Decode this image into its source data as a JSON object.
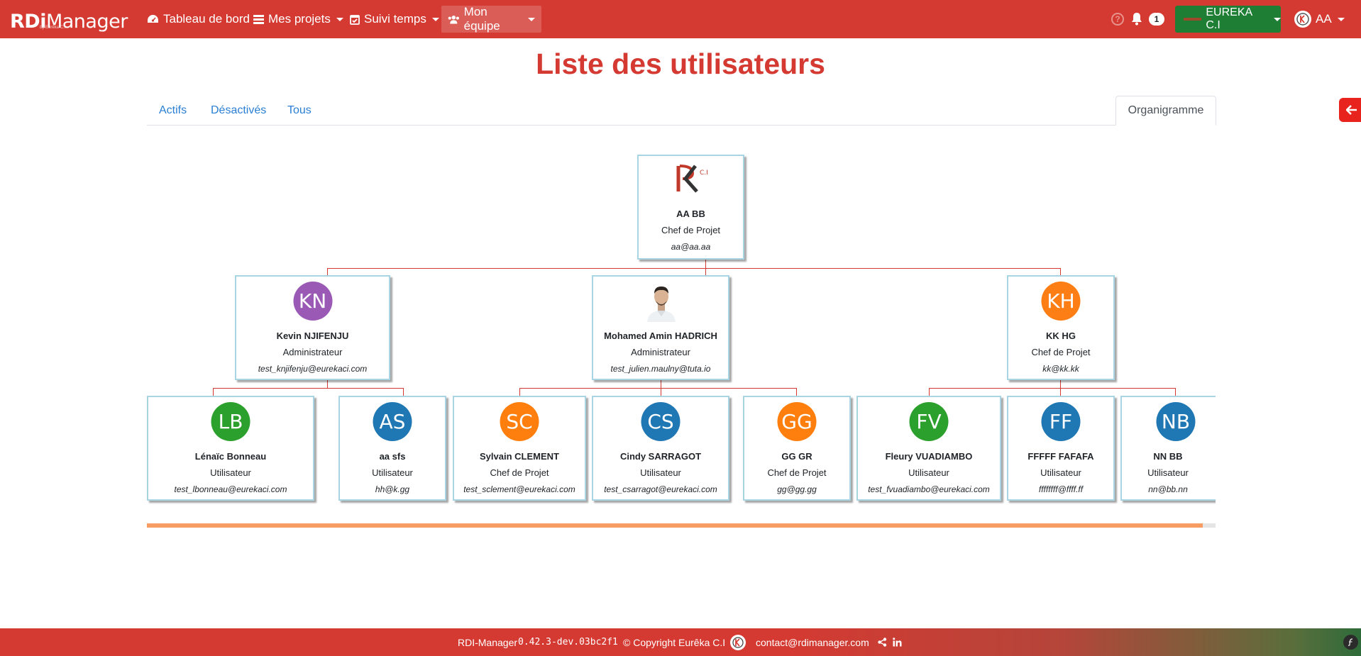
{
  "brand": {
    "name_part1": "RDi",
    "name_part2": "Manager",
    "tagline": "by Eurêka C.I"
  },
  "nav": {
    "items": [
      {
        "label": "Tableau de bord",
        "icon": "dashboard-icon"
      },
      {
        "label": "Mes projets",
        "icon": "list-icon"
      },
      {
        "label": "Suivi temps",
        "icon": "calendar-check-icon"
      },
      {
        "label": "Mon équipe",
        "icon": "users-icon",
        "active": true
      }
    ],
    "help": "?",
    "notifications_count": "1",
    "company": "EUREKA C.I",
    "user": "AA"
  },
  "page": {
    "title": "Liste des utilisateurs"
  },
  "tabs": {
    "active": "Actifs",
    "disabled": "Désactivés",
    "all": "Tous",
    "org": "Organigramme"
  },
  "org": {
    "root": {
      "name": "AA BB",
      "role": "Chef de Projet",
      "email": "aa@aa.aa"
    },
    "level1": [
      {
        "initials": "KN",
        "name": "Kevin NJIFENJU",
        "role": "Administrateur",
        "email": "test_knjifenju@eurekaci.com",
        "color": "#9b59b6"
      },
      {
        "initials": "",
        "name": "Mohamed Amin HADRICH",
        "role": "Administrateur",
        "email": "test_julien.maulny@tuta.io",
        "color": "#ffffff"
      },
      {
        "initials": "KH",
        "name": "KK HG",
        "role": "Chef de Projet",
        "email": "kk@kk.kk",
        "color": "#fd7e14"
      }
    ],
    "level2": [
      {
        "initials": "LB",
        "name": "Lénaïc Bonneau",
        "role": "Utilisateur",
        "email": "test_lbonneau@eurekaci.com",
        "color": "#2ca02c"
      },
      {
        "initials": "AS",
        "name": "aa sfs",
        "role": "Utilisateur",
        "email": "hh@k.gg",
        "color": "#1f77b4"
      },
      {
        "initials": "SC",
        "name": "Sylvain CLEMENT",
        "role": "Chef de Projet",
        "email": "test_sclement@eurekaci.com",
        "color": "#ff7f0e"
      },
      {
        "initials": "CS",
        "name": "Cindy SARRAGOT",
        "role": "Utilisateur",
        "email": "test_csarragot@eurekaci.com",
        "color": "#1f77b4"
      },
      {
        "initials": "GG",
        "name": "GG GR",
        "role": "Chef de Projet",
        "email": "gg@gg.gg",
        "color": "#ff7f0e"
      },
      {
        "initials": "FV",
        "name": "Fleury VUADIAMBO",
        "role": "Utilisateur",
        "email": "test_fvuadiambo@eurekaci.com",
        "color": "#2ca02c"
      },
      {
        "initials": "FF",
        "name": "FFFFF FAFAFA",
        "role": "Utilisateur",
        "email": "ffffffff@ffff.ff",
        "color": "#1f77b4"
      },
      {
        "initials": "NB",
        "name": "NN BB",
        "role": "Utilisateur",
        "email": "nn@bb.nn",
        "color": "#1f77b4"
      }
    ]
  },
  "footer": {
    "app": "RDI-Manager",
    "version": "0.42.3-dev.03bc2f1",
    "copyright": "© Copyright Eurêka C.I",
    "email": "contact@rdimanager.com"
  },
  "colors": {
    "primary": "#d43a32",
    "company_btn": "#1e7e34",
    "link": "#2a7fd4",
    "card_border": "#a9d4e3"
  }
}
